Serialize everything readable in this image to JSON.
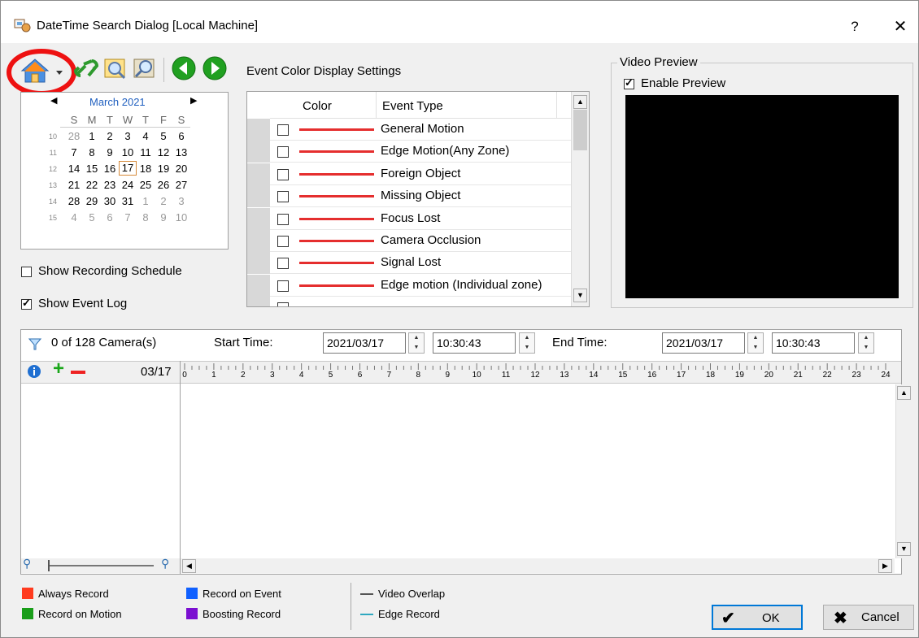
{
  "window": {
    "title": "DateTime Search Dialog [Local Machine]",
    "help_glyph": "?",
    "close_glyph": "✕"
  },
  "calendar": {
    "month_label": "March 2021",
    "weekdays": [
      "S",
      "M",
      "T",
      "W",
      "T",
      "F",
      "S"
    ],
    "week_numbers": [
      "10",
      "11",
      "12",
      "13",
      "14",
      "15"
    ],
    "weeks": [
      [
        "28",
        "1",
        "2",
        "3",
        "4",
        "5",
        "6"
      ],
      [
        "7",
        "8",
        "9",
        "10",
        "11",
        "12",
        "13"
      ],
      [
        "14",
        "15",
        "16",
        "17",
        "18",
        "19",
        "20"
      ],
      [
        "21",
        "22",
        "23",
        "24",
        "25",
        "26",
        "27"
      ],
      [
        "28",
        "29",
        "30",
        "31",
        "1",
        "2",
        "3"
      ],
      [
        "4",
        "5",
        "6",
        "7",
        "8",
        "9",
        "10"
      ]
    ],
    "selected_day": "17"
  },
  "options": {
    "show_recording_schedule": "Show Recording Schedule",
    "show_event_log": "Show Event Log"
  },
  "event_settings": {
    "title": "Event Color Display Settings",
    "col_color": "Color",
    "col_event": "Event Type",
    "rows": [
      "General Motion",
      "Edge Motion(Any Zone)",
      "Foreign Object",
      "Missing Object",
      "Focus Lost",
      "Camera Occlusion",
      "Signal Lost",
      "Edge motion (Individual zone)"
    ],
    "line_color": "#e52e2e"
  },
  "preview": {
    "group_label": "Video Preview",
    "enable_label": "Enable Preview"
  },
  "timebar": {
    "camera_count": "0 of 128 Camera(s)",
    "start_label": "Start Time:",
    "start_date": "2021/03/17",
    "start_time": "10:30:43",
    "end_label": "End Time:",
    "end_date": "2021/03/17",
    "end_time": "10:30:43",
    "date_label": "03/17",
    "hours": [
      "0",
      "1",
      "2",
      "3",
      "4",
      "5",
      "6",
      "7",
      "8",
      "9",
      "10",
      "11",
      "12",
      "13",
      "14",
      "15",
      "16",
      "17",
      "18",
      "19",
      "20",
      "21",
      "22",
      "23",
      "24"
    ]
  },
  "legend": {
    "always_record": "Always Record",
    "record_on_motion": "Record on Motion",
    "record_on_event": "Record on Event",
    "boosting_record": "Boosting Record",
    "video_overlap": "Video Overlap",
    "edge_record": "Edge Record",
    "colors": {
      "always": "#ff3b1f",
      "motion": "#1a9e1a",
      "event": "#1060ff",
      "boosting": "#7b0fd1",
      "overlap": "#555555",
      "edge": "#2fa8c0"
    }
  },
  "buttons": {
    "ok": "OK",
    "cancel": "Cancel"
  }
}
